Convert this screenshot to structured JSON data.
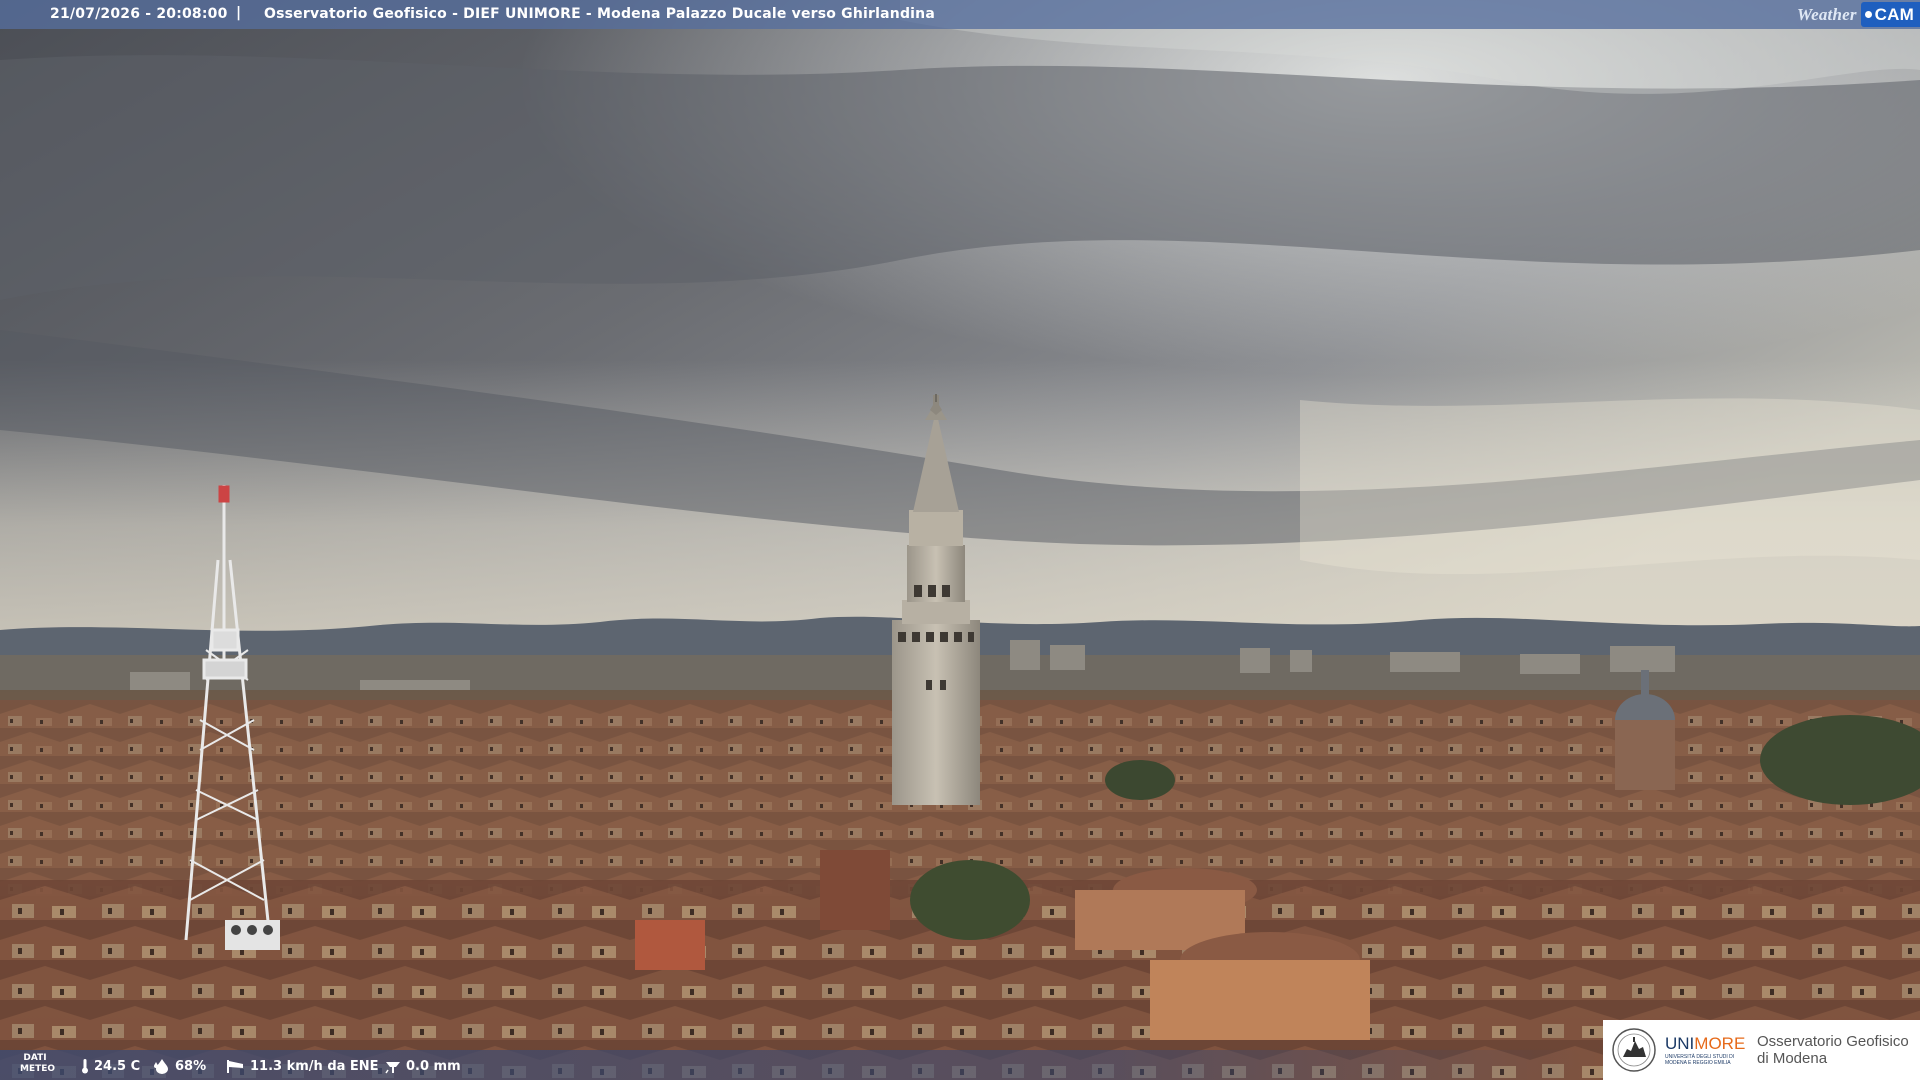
{
  "header": {
    "timestamp": "21/07/2026 - 20:08:00",
    "separator": "|",
    "title": "Osservatorio Geofisico - DIEF UNIMORE - Modena Palazzo Ducale verso Ghirlandina"
  },
  "brand": {
    "weather": "Weather",
    "cam": "CAM"
  },
  "weather_bar": {
    "label_line1": "DATI",
    "label_line2": "METEO",
    "temperature": "24.5 C",
    "humidity": "68%",
    "wind": "11.3 km/h da ENE",
    "rain": "0.0 mm"
  },
  "logo": {
    "uni_part1": "UNI",
    "uni_part2": "MORE",
    "uni_sub_line1": "UNIVERSITÀ DEGLI STUDI DI",
    "uni_sub_line2": "MODENA E REGGIO EMILIA",
    "obs_line1": "Osservatorio Geofisico",
    "obs_line2": "di Modena"
  },
  "colors": {
    "topbar": "#566e9e",
    "cam_badge": "#1f5fbf",
    "uni_blue": "#1c3a66",
    "uni_orange": "#e66a1a"
  },
  "icons": {
    "temperature": "thermometer-icon",
    "humidity": "droplet-icon",
    "wind": "windsock-icon",
    "rain": "rain-gauge-icon"
  }
}
